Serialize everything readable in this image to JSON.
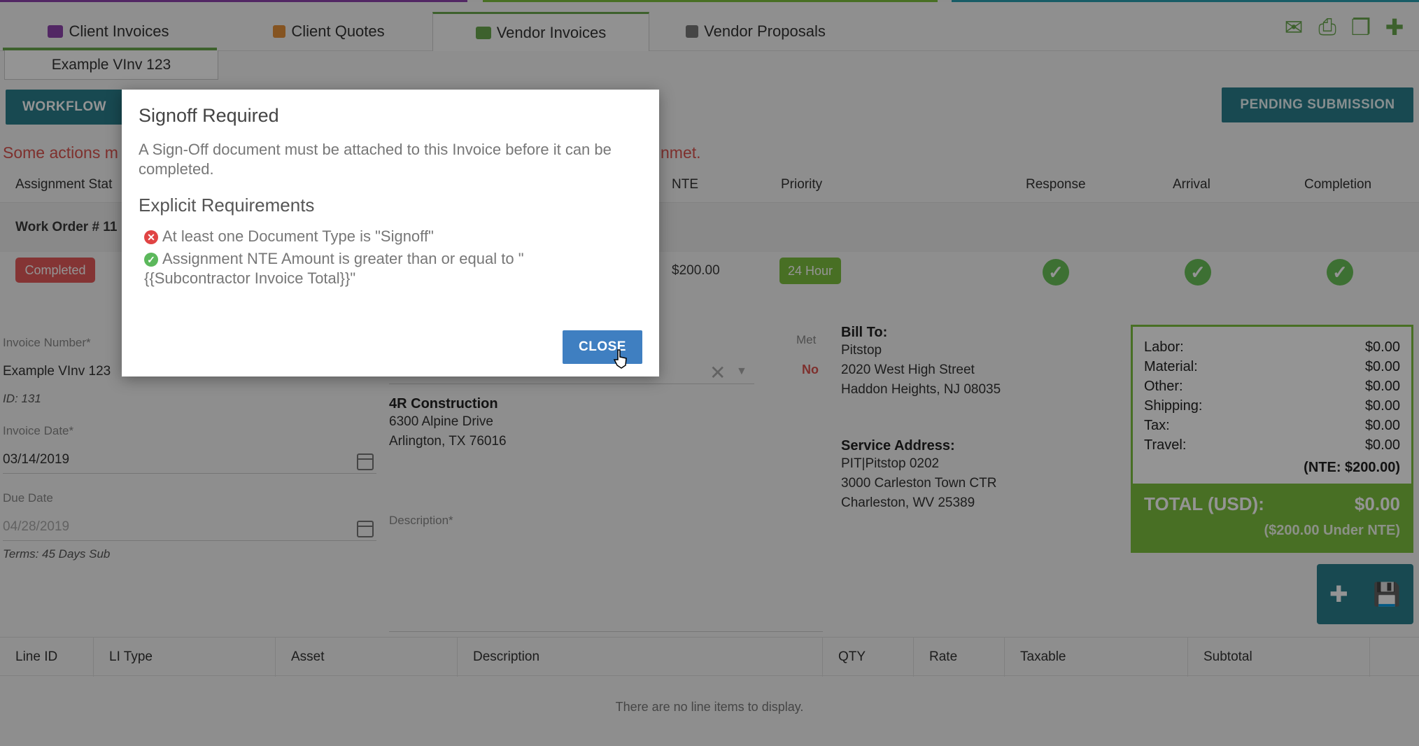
{
  "tabs": [
    {
      "label": "Client Invoices",
      "icon": "invoice-icon"
    },
    {
      "label": "Client Quotes",
      "icon": "quote-icon"
    },
    {
      "label": "Vendor Invoices",
      "icon": "invoice-icon"
    },
    {
      "label": "Vendor Proposals",
      "icon": "proposal-icon"
    }
  ],
  "subtab": "Example VInv 123",
  "workflow_label": "WORKFLOW",
  "pending_label": "PENDING SUBMISSION",
  "warning_left": "Some actions m",
  "warning_right": "nmet.",
  "grid_headers": {
    "assignment_status": "Assignment Stat",
    "nte": "NTE",
    "priority": "Priority",
    "response": "Response",
    "arrival": "Arrival",
    "completion": "Completion"
  },
  "work_order": "Work Order # 11",
  "status_badge": "Completed",
  "nte_value": "$200.00",
  "priority_badge": "24 Hour",
  "form": {
    "invoice_number_label": "Invoice Number*",
    "invoice_number": "Example VInv 123",
    "id_text": "ID: 131",
    "invoice_date_label": "Invoice Date*",
    "invoice_date": "03/14/2019",
    "due_date_label": "Due Date",
    "due_date": "04/28/2019",
    "terms": "Terms: 45 Days Sub",
    "description_label": "Description*",
    "met_label": "Met",
    "met_value": "No"
  },
  "vendor": {
    "name": "4R Construction",
    "line1": "6300 Alpine Drive",
    "line2": "Arlington, TX 76016"
  },
  "bill_to": {
    "title": "Bill To:",
    "name": "Pitstop",
    "line1": "2020 West High Street",
    "line2": "Haddon Heights, NJ 08035"
  },
  "service_address": {
    "title": "Service Address:",
    "name": "PIT|Pitstop 0202",
    "line1": "3000 Carleston Town CTR",
    "line2": "Charleston, WV 25389"
  },
  "summary": {
    "rows": [
      {
        "label": "Labor:",
        "value": "$0.00"
      },
      {
        "label": "Material:",
        "value": "$0.00"
      },
      {
        "label": "Other:",
        "value": "$0.00"
      },
      {
        "label": "Shipping:",
        "value": "$0.00"
      },
      {
        "label": "Tax:",
        "value": "$0.00"
      },
      {
        "label": "Travel:",
        "value": "$0.00"
      }
    ],
    "nte": "(NTE: $200.00)",
    "total_label": "TOTAL (USD):",
    "total_value": "$0.00",
    "under_nte": "($200.00 Under NTE)"
  },
  "line_item_headers": [
    "Line ID",
    "LI Type",
    "Asset",
    "Description",
    "QTY",
    "Rate",
    "Taxable",
    "Subtotal"
  ],
  "no_items": "There are no line items to display.",
  "modal": {
    "title": "Signoff Required",
    "body": "A Sign-Off document must be attached to this Invoice before it can be completed.",
    "subtitle": "Explicit Requirements",
    "req1": "At least one Document Type is \"Signoff\"",
    "req2": "Assignment NTE Amount is greater than or equal to \" {{Subcontractor Invoice Total}}\"",
    "close_label": "CLOSE"
  },
  "colors": {
    "green": "#6aa84f",
    "teal": "#2a7f8c",
    "red": "#d9534f",
    "blue": "#3f7fc1"
  }
}
